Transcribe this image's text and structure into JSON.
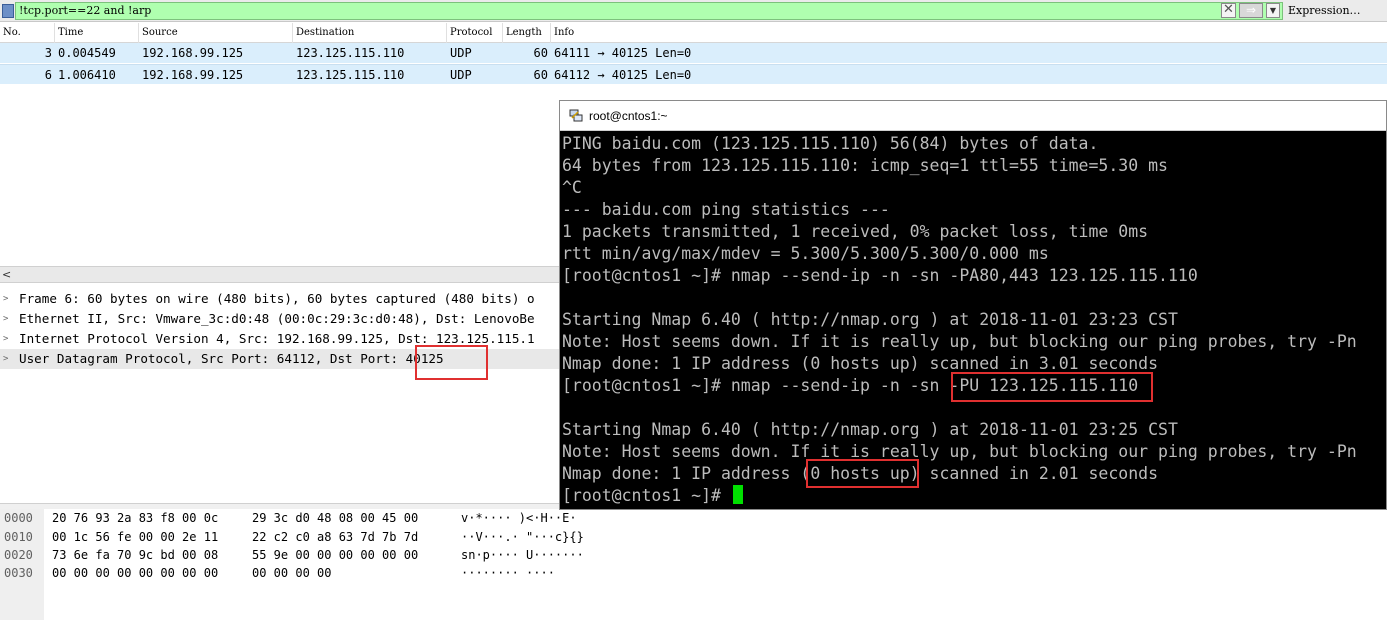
{
  "filter": {
    "expression": "!tcp.port==22 and !arp",
    "expression_button": "Expression…"
  },
  "packet_list": {
    "columns": [
      "No.",
      "Time",
      "Source",
      "Destination",
      "Protocol",
      "Length",
      "Info"
    ],
    "rows": [
      {
        "no": "3",
        "time": "0.004549",
        "source": "192.168.99.125",
        "destination": "123.125.115.110",
        "protocol": "UDP",
        "length": "60",
        "info": "64111 → 40125 Len=0"
      },
      {
        "no": "6",
        "time": "1.006410",
        "source": "192.168.99.125",
        "destination": "123.125.115.110",
        "protocol": "UDP",
        "length": "60",
        "info": "64112 → 40125 Len=0"
      }
    ]
  },
  "details": {
    "items": [
      {
        "text": "Frame 6: 60 bytes on wire (480 bits), 60 bytes captured (480 bits) o"
      },
      {
        "text": "Ethernet II, Src: Vmware_3c:d0:48 (00:0c:29:3c:d0:48), Dst: LenovoBe"
      },
      {
        "text": "Internet Protocol Version 4, Src: 192.168.99.125, Dst: 123.125.115.1"
      },
      {
        "text": "User Datagram Protocol, Src Port: 64112, Dst Port: 40125"
      }
    ]
  },
  "bytes": {
    "rows": [
      {
        "offset": "0000",
        "hex1": "20 76 93 2a 83 f8 00 0c",
        "hex2": "29 3c d0 48 08 00 45 00",
        "ascii": " v·*····  )<·H··E·"
      },
      {
        "offset": "0010",
        "hex1": "00 1c 56 fe 00 00 2e 11",
        "hex2": "22 c2 c0 a8 63 7d 7b 7d",
        "ascii": "··V···.· \"···c}{}"
      },
      {
        "offset": "0020",
        "hex1": "73 6e fa 70 9c bd 00 08",
        "hex2": "55 9e 00 00 00 00 00 00",
        "ascii": "sn·p···· U·······"
      },
      {
        "offset": "0030",
        "hex1": "00 00 00 00 00 00 00 00",
        "hex2": "00 00 00 00",
        "ascii": "········ ····"
      }
    ]
  },
  "terminal": {
    "title": "root@cntos1:~",
    "lines": [
      "PING baidu.com (123.125.115.110) 56(84) bytes of data.",
      "64 bytes from 123.125.115.110: icmp_seq=1 ttl=55 time=5.30 ms",
      "^C",
      "--- baidu.com ping statistics ---",
      "1 packets transmitted, 1 received, 0% packet loss, time 0ms",
      "rtt min/avg/max/mdev = 5.300/5.300/5.300/0.000 ms",
      "[root@cntos1 ~]# nmap --send-ip -n -sn -PA80,443 123.125.115.110",
      "",
      "Starting Nmap 6.40 ( http://nmap.org ) at 2018-11-01 23:23 CST",
      "Note: Host seems down. If it is really up, but blocking our ping probes, try -Pn",
      "Nmap done: 1 IP address (0 hosts up) scanned in 3.01 seconds",
      "[root@cntos1 ~]# nmap --send-ip -n -sn -PU 123.125.115.110",
      "",
      "Starting Nmap 6.40 ( http://nmap.org ) at 2018-11-01 23:25 CST",
      "Note: Host seems down. If it is really up, but blocking our ping probes, try -Pn",
      "Nmap done: 1 IP address (0 hosts up) scanned in 2.01 seconds",
      "[root@cntos1 ~]# "
    ],
    "cursor_color": "#00e000"
  },
  "colors": {
    "filter_valid": "#afffaf",
    "row_selected": "#daeefc",
    "annotation": "#e03030",
    "terminal_bg": "#000000",
    "terminal_fg": "#bcbcbc"
  }
}
